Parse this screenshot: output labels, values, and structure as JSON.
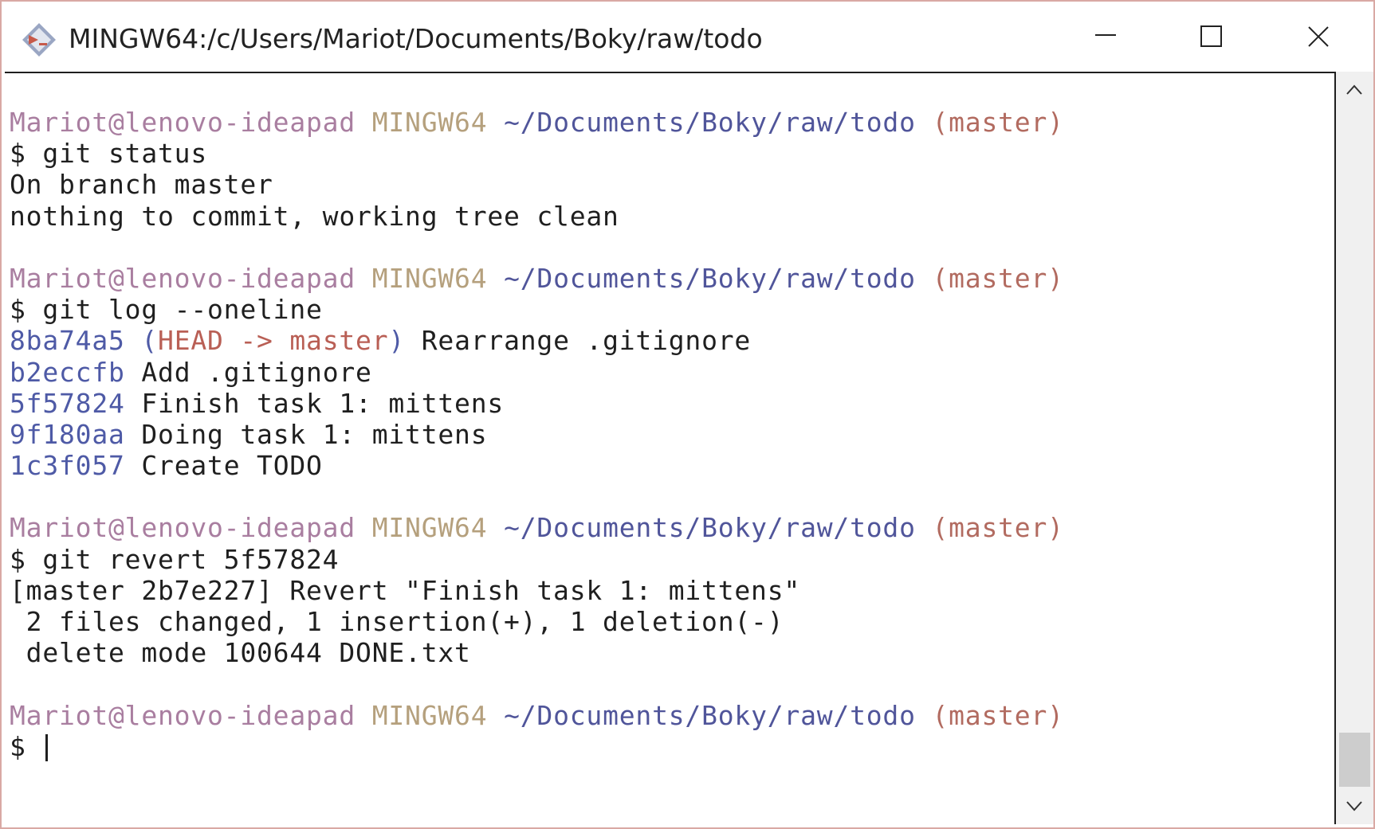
{
  "window": {
    "title": "MINGW64:/c/Users/Mariot/Documents/Boky/raw/todo"
  },
  "colors": {
    "prompt_user": "#a97ea0",
    "prompt_system": "#b5a07d",
    "prompt_path": "#50559a",
    "prompt_branch": "#b26b60",
    "commit_hash": "#4e5aa6",
    "head_ref": "#b95f55"
  },
  "prompt": {
    "user_host": "Mariot@lenovo-ideapad",
    "system": "MINGW64",
    "path": "~/Documents/Boky/raw/todo",
    "branch": "(master)"
  },
  "session": {
    "cmd1": "$ git status",
    "out1_line1": "On branch master",
    "out1_line2": "nothing to commit, working tree clean",
    "cmd2": "$ git log --oneline",
    "log": [
      {
        "hash": "8ba74a5",
        "message": "Rearrange .gitignore"
      },
      {
        "hash": "b2eccfb",
        "message": "Add .gitignore"
      },
      {
        "hash": "5f57824",
        "message": "Finish task 1: mittens"
      },
      {
        "hash": "9f180aa",
        "message": "Doing task 1: mittens"
      },
      {
        "hash": "1c3f057",
        "message": "Create TODO"
      }
    ],
    "head_open": "(",
    "head_ref": "HEAD -> master",
    "head_close": ")",
    "cmd3": "$ git revert 5f57824",
    "out3_line1": "[master 2b7e227] Revert \"Finish task 1: mittens\"",
    "out3_line2": " 2 files changed, 1 insertion(+), 1 deletion(-)",
    "out3_line3": " delete mode 100644 DONE.txt",
    "current_prompt": "$ "
  }
}
